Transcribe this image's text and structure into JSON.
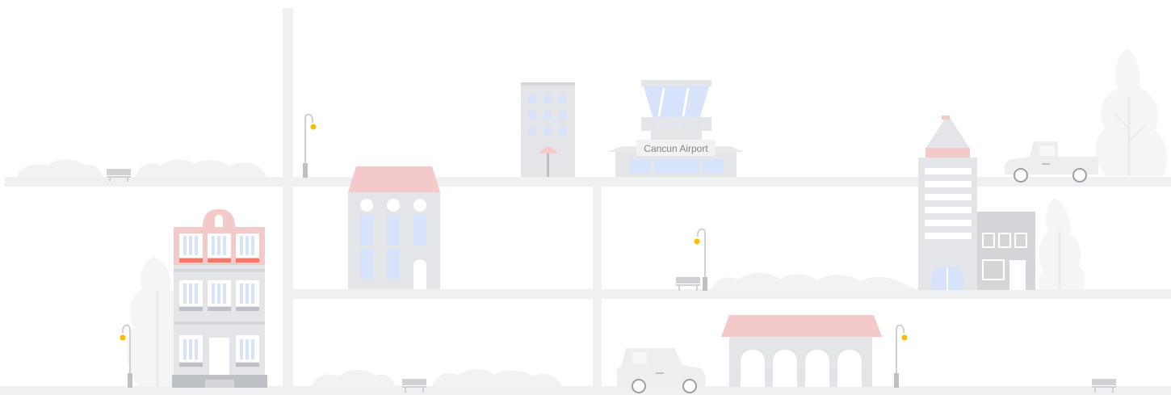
{
  "scene": {
    "airport_sign": "Cancun Airport"
  },
  "colors": {
    "road": "#eef0f1",
    "building_gray": "#e3e5e8",
    "building_dark": "#d4d6d9",
    "roof_pink": "#f4c9c9",
    "window_blue": "#d6e3fb",
    "accent_red": "#ee7b6a",
    "lamp_light": "#fbbc04",
    "foliage": "#f3f4f5"
  }
}
